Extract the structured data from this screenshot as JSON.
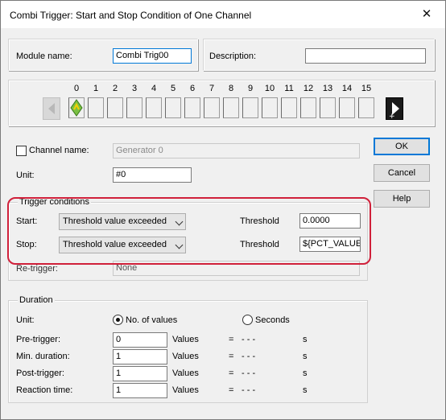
{
  "window": {
    "title": "Combi Trigger: Start and Stop Condition of One Channel",
    "close_glyph": "✕"
  },
  "module": {
    "name_label": "Module name:",
    "name_value": "Combi Trig00",
    "desc_label": "Description:",
    "desc_value": ""
  },
  "channels": {
    "numbers": [
      "0",
      "1",
      "2",
      "3",
      "4",
      "5",
      "6",
      "7",
      "8",
      "9",
      "10",
      "11",
      "12",
      "13",
      "14",
      "15"
    ],
    "selected": "0"
  },
  "channel_name": {
    "checkbox_label": "Channel name:",
    "checked": false,
    "value": "Generator 0"
  },
  "unit": {
    "label": "Unit:",
    "value": "#0"
  },
  "buttons": {
    "ok": "OK",
    "cancel": "Cancel",
    "help": "Help"
  },
  "trigger": {
    "group_label": "Trigger conditions",
    "start_label": "Start:",
    "start_value": "Threshold value exceeded",
    "start_threshold_label": "Threshold",
    "start_threshold_value": "0.0000",
    "stop_label": "Stop:",
    "stop_value": "Threshold value exceeded",
    "stop_threshold_label": "Threshold",
    "stop_threshold_value": "${PCT_VALUE",
    "retrigger_label": "Re-trigger:",
    "retrigger_value": "None"
  },
  "duration": {
    "group_label": "Duration",
    "unit_label": "Unit:",
    "opt_values": "No. of values",
    "opt_values_selected": true,
    "opt_seconds": "Seconds",
    "opt_seconds_selected": false,
    "rows": [
      {
        "label": "Pre-trigger:",
        "value": "0",
        "unit": "Values",
        "eq": "=",
        "dashes": "- - -",
        "s": "s"
      },
      {
        "label": "Min. duration:",
        "value": "1",
        "unit": "Values",
        "eq": "=",
        "dashes": "- - -",
        "s": "s"
      },
      {
        "label": "Post-trigger:",
        "value": "1",
        "unit": "Values",
        "eq": "=",
        "dashes": "- - -",
        "s": "s"
      },
      {
        "label": "Reaction time:",
        "value": "1",
        "unit": "Values",
        "eq": "=",
        "dashes": "- - -",
        "s": "s"
      }
    ]
  },
  "colors": {
    "highlight": "#d0203a",
    "focus": "#0078d7",
    "channel_icon": "#7bc043"
  }
}
